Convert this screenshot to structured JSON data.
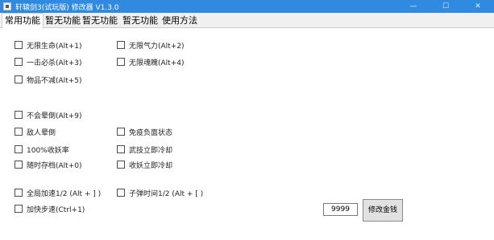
{
  "window": {
    "title": "轩辕剑3(试玩版) 修改器  V1.3.0",
    "min_glyph": "—",
    "max_glyph": "☐",
    "close_glyph": "✕",
    "accent": "#2f8ae0"
  },
  "tabs": [
    {
      "label": "常用功能",
      "active": true
    },
    {
      "label": "暂无功能"
    },
    {
      "label": "暂无功能"
    },
    {
      "label": "暂无功能"
    },
    {
      "label": "使用方法"
    }
  ],
  "options": {
    "infinite_hp": "无限生命(Alt+1)",
    "infinite_qi": "无限气力(Alt+2)",
    "one_hit_kill": "一击必杀(Alt+3)",
    "infinite_soul": "无限魂魄(Alt+4)",
    "items_no_decrease": "物品不减(Alt+5)",
    "no_faint": "不会晕倒(Alt+9)",
    "enemy_faint": "敌人晕倒",
    "immune_debuff": "免疫负面状态",
    "capture_rate": "100%收妖率",
    "skill_cooldown": "武技立即冷却",
    "save_anytime": "随时存档(Alt+0)",
    "capture_cooldown": "收妖立即冷却",
    "global_speed": "全局加速1/2 (Alt + ] )",
    "bullet_time": "子弹时间1/2 (Alt + [ )",
    "walk_speed": "加快步速(Ctrl+1)"
  },
  "money": {
    "value": "9999",
    "button_label": "修改金钱"
  }
}
